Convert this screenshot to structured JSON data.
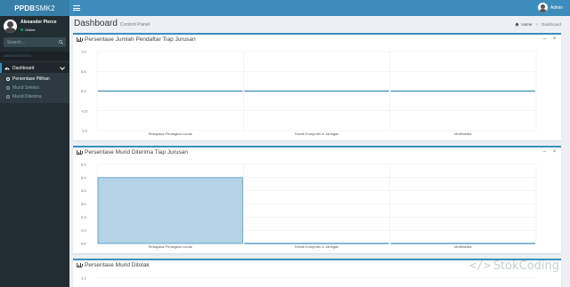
{
  "app": {
    "logo_bold": "PPDB",
    "logo_rest": "SMK2"
  },
  "topbar": {
    "menu_icon": "hamburger-icon",
    "user_name": "Admin"
  },
  "sidebar": {
    "user": {
      "name": "Alexander Pierce",
      "status": "Online"
    },
    "search": {
      "placeholder": "Search..."
    },
    "nav_header": "MAIN NAVIGATION",
    "menu": [
      {
        "label": "Dashboard",
        "icon": "dashboard-icon",
        "expanded": true,
        "children": [
          {
            "label": "Persentase Pilihan",
            "active": true
          },
          {
            "label": "Murid Seleksi",
            "active": false
          },
          {
            "label": "Murid Diterima",
            "active": false
          }
        ]
      }
    ]
  },
  "content": {
    "title": "Dashboard",
    "subtitle": "Control Panel",
    "breadcrumb": [
      {
        "label": "Home",
        "icon": "home-icon"
      },
      {
        "label": "Dashboard"
      }
    ]
  },
  "boxes": [
    {
      "title": "Persentase Jumlah Pendaftar Tiap Jurusan"
    },
    {
      "title": "Persentase Murid Diterima Tiap Jurusan"
    },
    {
      "title": "Persentase Murid Ditolak"
    }
  ],
  "chart_data": [
    {
      "type": "bar",
      "title": "Persentase Jumlah Pendaftar Tiap Jurusan",
      "categories": [
        "Rekayasa Perangkat Lunak",
        "Teknik Komputer & Jaringan",
        "Multimedia"
      ],
      "values": [
        0,
        0,
        0
      ],
      "ylim": [
        -1.0,
        1.0
      ],
      "yticks": [
        "1.0",
        "0.5",
        "0.0",
        "-0.5",
        "-1.0"
      ],
      "ytick_values": [
        1.0,
        0.5,
        0.0,
        -0.5,
        -1.0
      ],
      "grid": true,
      "bar_color": "#3c8dbc"
    },
    {
      "type": "bar",
      "title": "Persentase Murid Diterima Tiap Jurusan",
      "categories": [
        "Rekayasa Perangkat Lunak",
        "Teknik Komputer & Jaringan",
        "Multimedia"
      ],
      "values": [
        5,
        0,
        0
      ],
      "ylim": [
        0,
        6.0
      ],
      "yticks": [
        "6.0",
        "5.0",
        "4.0",
        "3.0",
        "2.0",
        "1.0",
        "0.0"
      ],
      "ytick_values": [
        6,
        5,
        4,
        3,
        2,
        1,
        0
      ],
      "grid": true,
      "bar_color": "#3c8dbc",
      "bar_fill": "#b5d3e7"
    },
    {
      "type": "bar",
      "title": "Persentase Murid Ditolak",
      "categories": [],
      "values": [],
      "yticks": [
        "1.2"
      ],
      "ytick_values": [
        1.2
      ],
      "grid": true
    }
  ],
  "colors": {
    "primary": "#3c8dbc",
    "logo_bg": "#367fa9",
    "sidebar_bg": "#222d32",
    "online": "#00a65a"
  },
  "watermark": {
    "text": "StokCoding",
    "icon": "code-bracket-icon"
  }
}
